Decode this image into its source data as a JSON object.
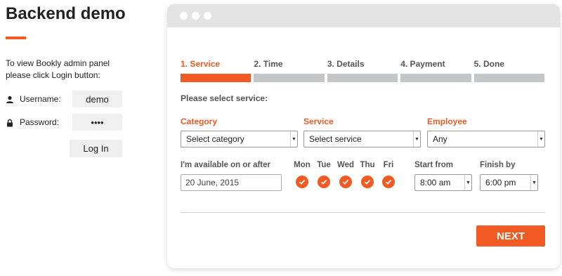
{
  "left": {
    "title": "Backend demo",
    "instruction_line1": "To view Bookly admin panel",
    "instruction_line2": "please click Login button:",
    "username_label": "Username:",
    "username_value": "demo",
    "password_label": "Password:",
    "password_value": "••••",
    "login_label": "Log In"
  },
  "steps": [
    {
      "label": "1. Service",
      "active": true
    },
    {
      "label": "2. Time",
      "active": false
    },
    {
      "label": "3. Details",
      "active": false
    },
    {
      "label": "4. Payment",
      "active": false
    },
    {
      "label": "5. Done",
      "active": false
    }
  ],
  "form": {
    "section_title": "Please select service:",
    "category_label": "Category",
    "category_value": "Select category",
    "service_label": "Service",
    "service_value": "Select service",
    "employee_label": "Employee",
    "employee_value": "Any",
    "available_label": "I'm available on or after",
    "date_value": "20 June, 2015",
    "days": [
      "Mon",
      "Tue",
      "Wed",
      "Thu",
      "Fri"
    ],
    "start_label": "Start from",
    "start_value": "8:00 am",
    "finish_label": "Finish by",
    "finish_value": "6:00 pm",
    "next_label": "NEXT"
  },
  "colors": {
    "accent": "#f15a22",
    "step_inactive": "#c4c7c9"
  }
}
